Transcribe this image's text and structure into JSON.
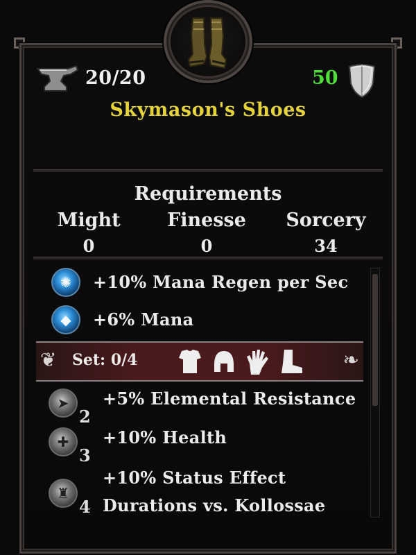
{
  "item": {
    "name": "Skymason's Shoes",
    "durability": "20/20",
    "armor": "50",
    "icon": "boots-icon"
  },
  "requirements": {
    "title": "Requirements",
    "columns": [
      {
        "label": "Might",
        "value": "0"
      },
      {
        "label": "Finesse",
        "value": "0"
      },
      {
        "label": "Sorcery",
        "value": "34"
      }
    ]
  },
  "bonuses": [
    {
      "text": "+10% Mana Regen per Sec",
      "icon": "mana-regen-icon"
    },
    {
      "text": "+6% Mana",
      "icon": "mana-drop-icon"
    }
  ],
  "set": {
    "label": "Set: 0/4",
    "pieces": [
      "chest-icon",
      "helm-icon",
      "gloves-icon",
      "boots-icon"
    ],
    "bonuses": [
      {
        "count": "2",
        "text": "+5% Elemental Resistance",
        "icon": "elemental-icon"
      },
      {
        "count": "3",
        "text": "+10% Health",
        "icon": "health-icon"
      },
      {
        "count": "4",
        "line1": "+10% Status Effect",
        "line2": "Durations vs. Kollossae",
        "icon": "status-effect-icon"
      }
    ]
  },
  "colors": {
    "item_name": "#e4d23a",
    "armor_value": "#4fdd3a",
    "text": "#ecebea"
  }
}
